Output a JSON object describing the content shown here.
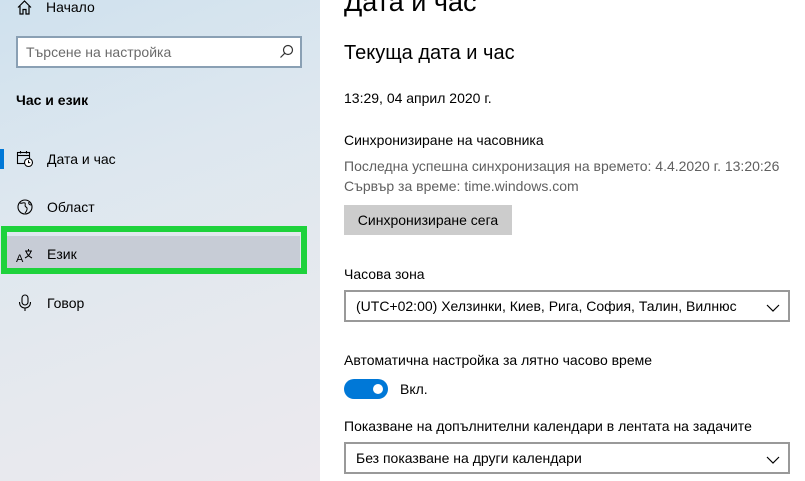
{
  "sidebar": {
    "home_label": "Начало",
    "search_placeholder": "Търсене на настройка",
    "section_title": "Час и език",
    "items": [
      {
        "label": "Дата и час",
        "icon": "calendar-clock-icon",
        "selected": true
      },
      {
        "label": "Област",
        "icon": "globe-icon",
        "selected": false
      },
      {
        "label": "Език",
        "icon": "language-icon",
        "selected": false,
        "hovered": true
      },
      {
        "label": "Говор",
        "icon": "microphone-icon",
        "selected": false
      }
    ]
  },
  "main": {
    "page_title": "Дата и час",
    "current_heading": "Текуща дата и час",
    "current_datetime": "13:29, 04 април 2020 г.",
    "sync": {
      "heading": "Синхронизиране на часовника",
      "last_sync": "Последна успешна синхронизация на времето: 4.4.2020 г. 13:20:26",
      "server": "Сървър за време: time.windows.com",
      "button_label": "Синхронизиране сега"
    },
    "timezone": {
      "label": "Часова зона",
      "value": "(UTC+02:00) Хелзинки, Киев, Рига, София, Талин, Вилнюс"
    },
    "dst": {
      "label": "Автоматична настройка за лятно часово време",
      "state": "Вкл.",
      "on": true
    },
    "calendars": {
      "label": "Показване на допълнителни календари в лентата на задачите",
      "value": "Без показване на други календари"
    }
  },
  "colors": {
    "accent": "#0078d7",
    "highlight": "#1ed23c"
  }
}
